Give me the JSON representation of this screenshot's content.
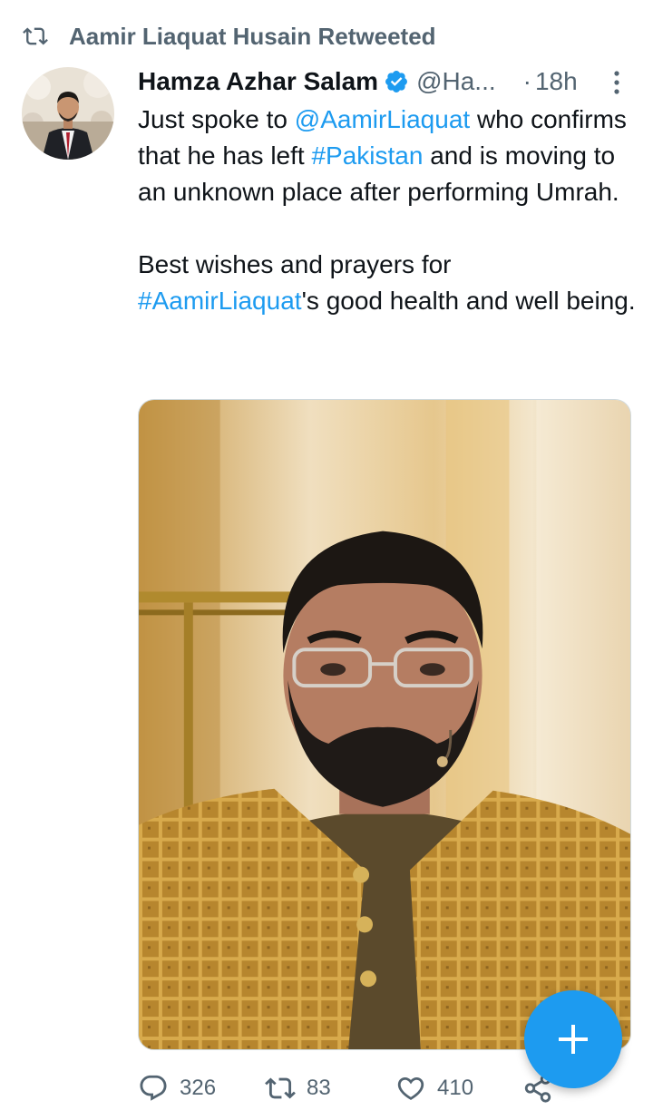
{
  "retweet_context": {
    "text": "Aamir Liaquat Husain Retweeted",
    "icon": "retweet-icon"
  },
  "tweet": {
    "author_name": "Hamza Azhar Salam",
    "verified": true,
    "handle": "@Ha...",
    "separator": "·",
    "time": "18h",
    "text": {
      "p1_a": "Just spoke to ",
      "p1_mention": "@AamirLiaquat",
      "p1_b": " who confirms that he has left ",
      "p1_hashtag": "#Pakistan",
      "p1_c": " and is moving to an unknown place after performing Umrah.",
      "p2_a": "Best wishes and prayers for ",
      "p2_hashtag": "#AamirLiaquat",
      "p2_b": "'s good health and well being."
    },
    "media": {
      "type": "photo",
      "subject": "man-portrait-photo"
    }
  },
  "actions": {
    "reply_count": "326",
    "retweet_count": "83",
    "like_count": "410"
  },
  "compose_button": {
    "icon": "plus-icon"
  },
  "colors": {
    "accent": "#1d9bf0",
    "secondary_text": "#536471",
    "primary_text": "#0f1419"
  }
}
